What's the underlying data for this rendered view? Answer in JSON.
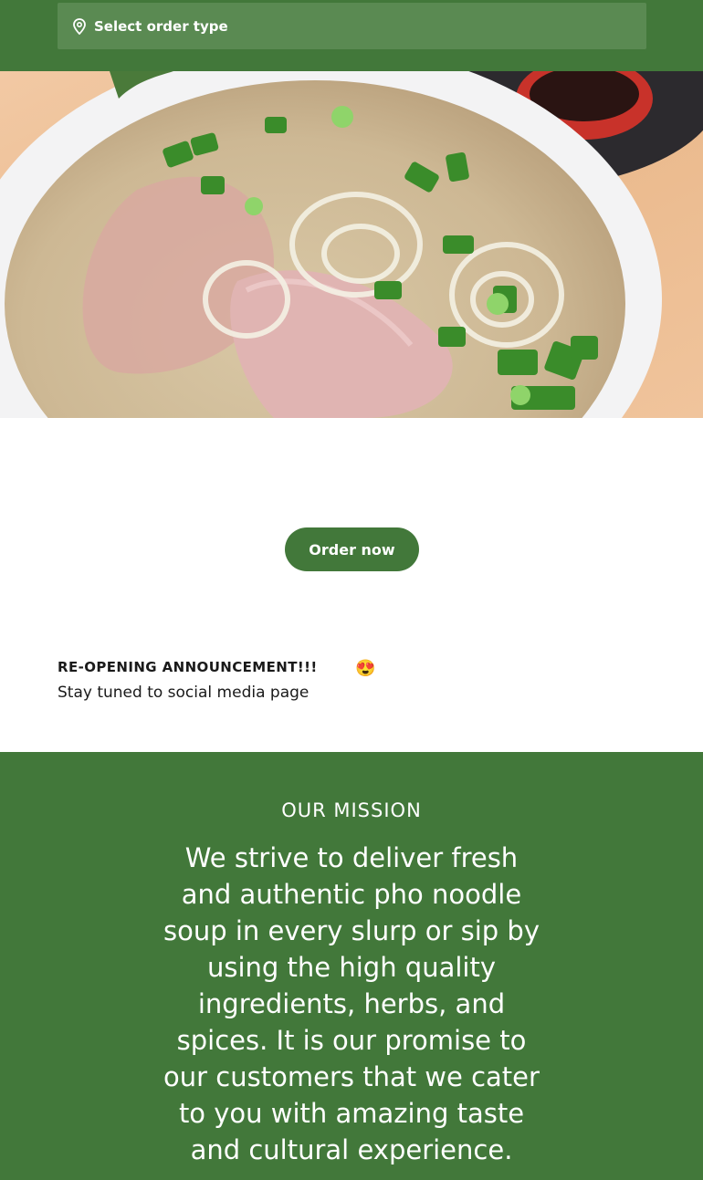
{
  "header": {
    "order_type_label": "Select order type",
    "icon": "location-pin-icon"
  },
  "hero": {
    "image": "pho-noodle-soup-photo"
  },
  "cta": {
    "order_now_label": "Order now"
  },
  "announcement": {
    "title": "RE-OPENING ANNOUNCEMENT!!!",
    "emoji": "😍",
    "body": "Stay tuned to social media page"
  },
  "mission": {
    "heading": "OUR MISSION",
    "text": "We strive to deliver fresh and authentic pho noodle soup in every slurp or sip by using the high quality ingredients, herbs, and spices. It is our promise to our customers that we cater to you with amazing taste and cultural experience."
  },
  "colors": {
    "brand_green": "#42783a",
    "field_green": "#5a8a52"
  }
}
